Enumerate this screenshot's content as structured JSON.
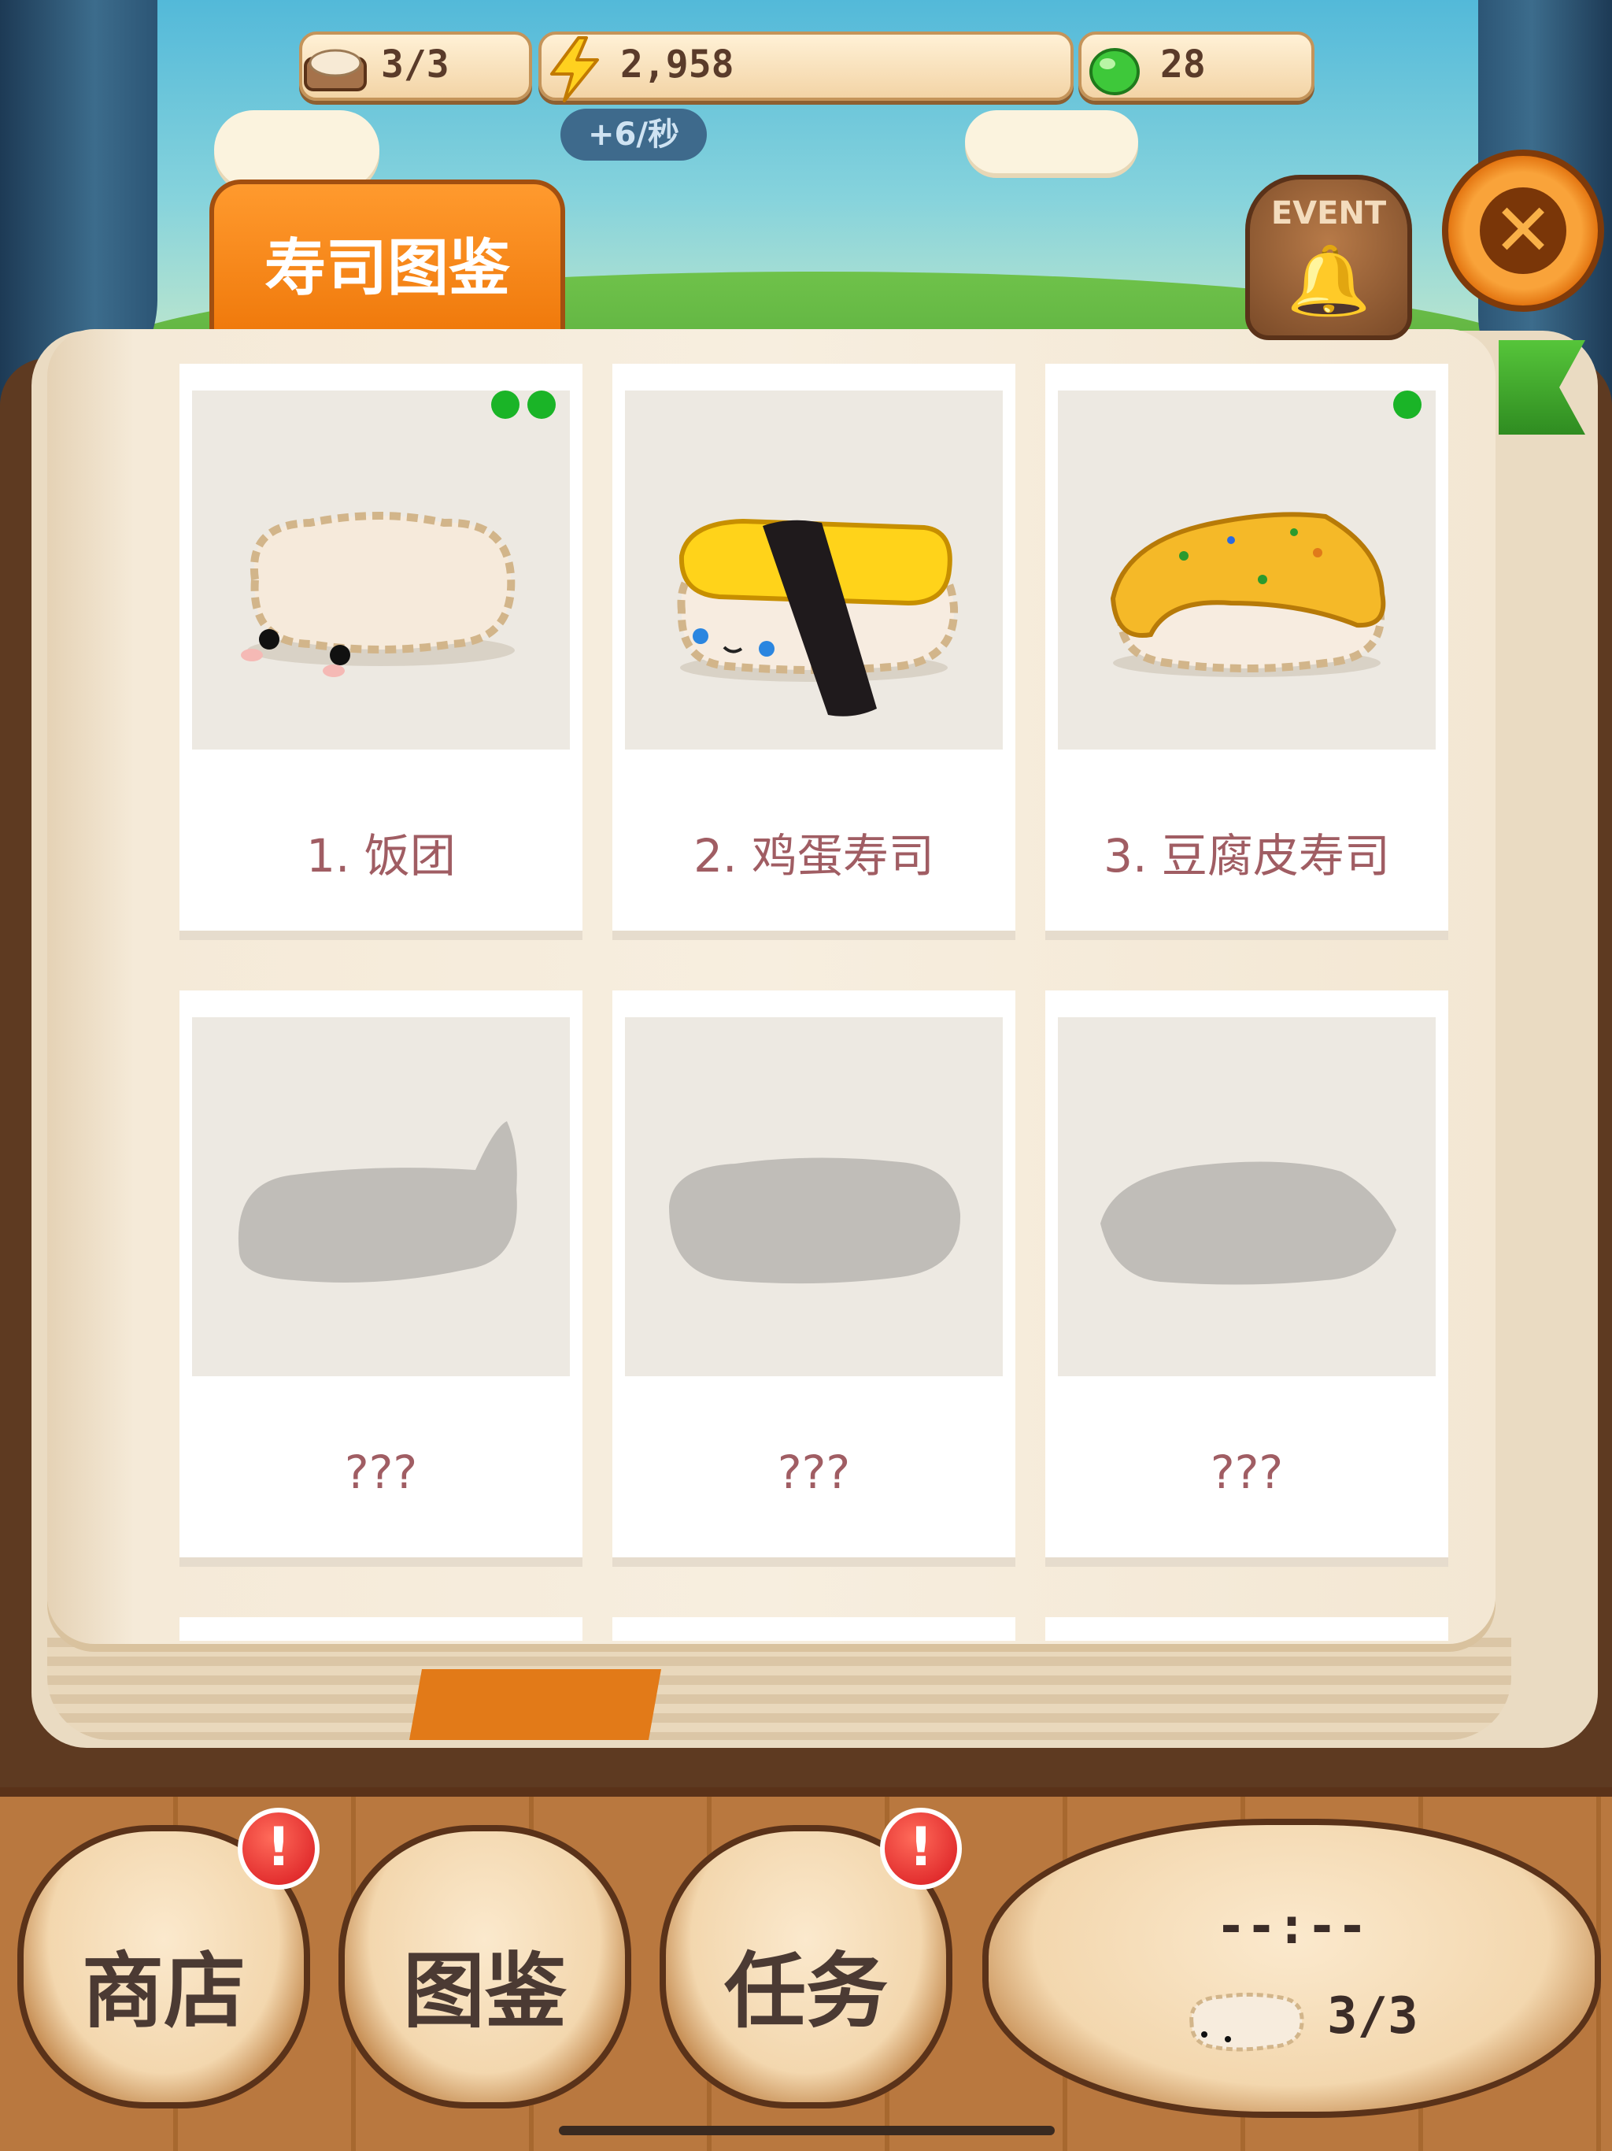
{
  "top_bar": {
    "capacity": "3/3",
    "energy": "2,958",
    "energy_rate": "+6/秒",
    "gems": "28"
  },
  "header": {
    "tab_title": "寿司图鉴",
    "event_label": "EVENT"
  },
  "collection": {
    "items": [
      {
        "name": "1. 饭团",
        "dots": 2,
        "unlocked": true
      },
      {
        "name": "2. 鸡蛋寿司",
        "dots": 0,
        "unlocked": true
      },
      {
        "name": "3. 豆腐皮寿司",
        "dots": 1,
        "unlocked": true
      },
      {
        "name": "???",
        "dots": 0,
        "unlocked": false
      },
      {
        "name": "???",
        "dots": 0,
        "unlocked": false
      },
      {
        "name": "???",
        "dots": 0,
        "unlocked": false
      }
    ]
  },
  "bottom_nav": {
    "shop_label": "商店",
    "collection_label": "图鉴",
    "tasks_label": "任务",
    "badge_mark": "!",
    "timer": "--:--",
    "queue": "3/3"
  },
  "colors": {
    "accent_orange": "#f07a0c",
    "dot_green": "#1ab427",
    "item_name": "#a05d63"
  }
}
